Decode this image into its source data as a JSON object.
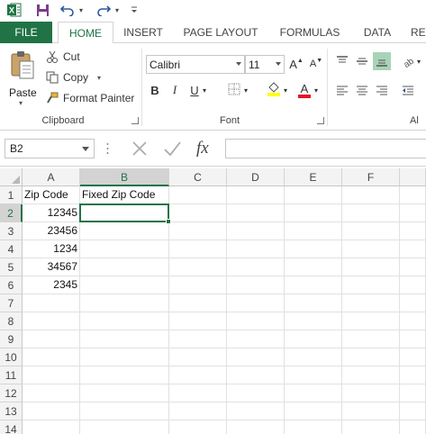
{
  "accent": "#217346",
  "qat": {
    "excel_icon": "excel-logo",
    "save_icon": "save-icon",
    "undo_icon": "undo-icon",
    "redo_icon": "redo-icon",
    "customize_icon": "customize-qat-icon"
  },
  "tabs": [
    "FILE",
    "HOME",
    "INSERT",
    "PAGE LAYOUT",
    "FORMULAS",
    "DATA",
    "RE"
  ],
  "active_tab": "HOME",
  "clipboard": {
    "paste_label": "Paste",
    "cut_label": "Cut",
    "copy_label": "Copy",
    "format_painter_label": "Format Painter",
    "group_label": "Clipboard"
  },
  "font": {
    "family": "Calibri",
    "size": "11",
    "bold": "B",
    "italic": "I",
    "underline": "U",
    "grow": "A",
    "shrink": "A",
    "font_color_letter": "A",
    "group_label": "Font"
  },
  "alignment": {
    "group_label": "Al"
  },
  "formula_bar": {
    "name_box": "B2",
    "cancel_icon": "cancel-x-icon",
    "enter_icon": "enter-check-icon",
    "fx_label": "fx",
    "formula_value": ""
  },
  "grid": {
    "columns": [
      "A",
      "B",
      "C",
      "D",
      "E",
      "F"
    ],
    "rows": [
      "1",
      "2",
      "3",
      "4",
      "5",
      "6",
      "7",
      "8",
      "9",
      "10",
      "11",
      "12",
      "13",
      "14"
    ],
    "selected_cell": "B2",
    "cells": {
      "A1": "Zip Code",
      "B1": "Fixed Zip Code",
      "A2": "12345",
      "A3": "23456",
      "A4": "1234",
      "A5": "34567",
      "A6": "2345"
    }
  }
}
